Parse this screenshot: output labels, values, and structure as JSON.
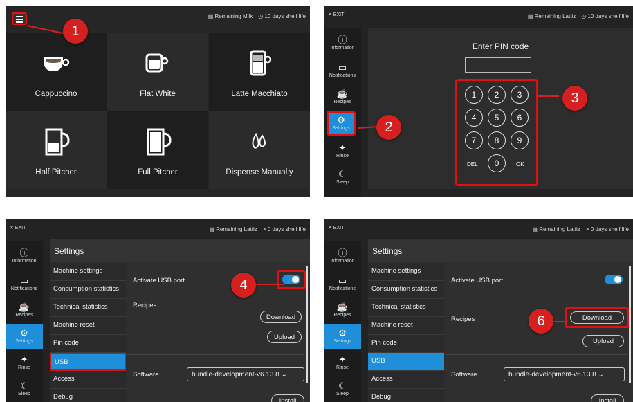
{
  "panel1": {
    "top_status": {
      "remaining": "Remaining Milk",
      "shelf": "10 days shelf life"
    },
    "tiles": [
      {
        "label": "Cappuccino",
        "icon": "cappuccino-cup-icon"
      },
      {
        "label": "Flat White",
        "icon": "flat-white-cup-icon"
      },
      {
        "label": "Latte Macchiato",
        "icon": "latte-glass-icon"
      },
      {
        "label": "Half Pitcher",
        "icon": "half-pitcher-icon"
      },
      {
        "label": "Full Pitcher",
        "icon": "full-pitcher-icon"
      },
      {
        "label": "Dispense Manually",
        "icon": "drops-icon"
      }
    ],
    "step": "1"
  },
  "panel2": {
    "exit": "✕ EXIT",
    "top_status": {
      "remaining": "Remaining Lattiz",
      "shelf": "10 days shelf life"
    },
    "sidebar": [
      {
        "label": "Information",
        "icon": "info-icon"
      },
      {
        "label": "Notifications",
        "icon": "message-icon"
      },
      {
        "label": "Recipes",
        "icon": "cup-icon"
      },
      {
        "label": "Settings",
        "icon": "gears-icon"
      },
      {
        "label": "Rinse",
        "icon": "sparkle-icon"
      },
      {
        "label": "Sleep",
        "icon": "moon-icon"
      }
    ],
    "pin_title": "Enter PIN code",
    "keys": [
      "1",
      "2",
      "3",
      "4",
      "5",
      "6",
      "7",
      "8",
      "9",
      "0"
    ],
    "del": "DEL",
    "ok": "OK",
    "steps": [
      "2",
      "3"
    ]
  },
  "panel3": {
    "exit": "✕ EXIT",
    "top_status": {
      "remaining": "Remaining Lattiz",
      "shelf": "0 days shelf life"
    },
    "step": "4"
  },
  "panel4": {
    "exit": "✕ EXIT",
    "top_status": {
      "remaining": "Remaining Lattiz",
      "shelf": "0 days shelf life"
    },
    "step": "6"
  },
  "settings": {
    "title": "Settings",
    "menu": [
      "Machine settings",
      "Consumption statistics",
      "Technical statistics",
      "Machine reset",
      "Pin code",
      "USB",
      "Access",
      "Debug"
    ],
    "activate_usb": "Activate USB port",
    "recipes": "Recipes",
    "download": "Download",
    "upload": "Upload",
    "software": "Software",
    "software_value": "bundle-development-v6.13.8",
    "install": "Install"
  },
  "colors": {
    "accent": "#1e8fd8",
    "highlight": "#d62020",
    "background": "#232323"
  }
}
